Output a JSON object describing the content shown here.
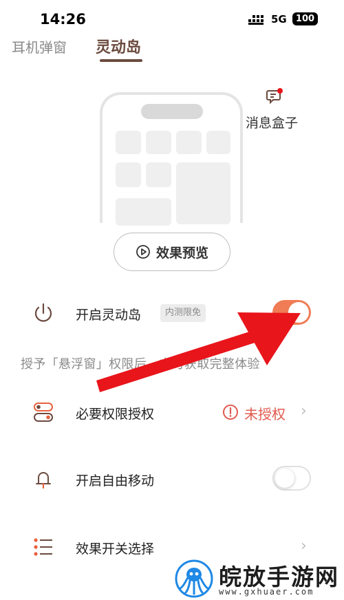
{
  "status_bar": {
    "time": "14:26",
    "network": "5G",
    "battery": "100"
  },
  "tabs": [
    {
      "label": "耳机弹窗"
    },
    {
      "label": "灵动岛"
    }
  ],
  "message_box": {
    "label": "消息盒子"
  },
  "preview_button": {
    "label": "效果预览"
  },
  "rows": {
    "enable_island": {
      "label": "开启灵动岛",
      "badge": "内测限免",
      "toggle_on": true
    },
    "hint": "授予「悬浮窗」权限后，方可获取完整体验",
    "permission": {
      "label": "必要权限授权",
      "status": "未授权"
    },
    "free_move": {
      "label": "开启自由移动",
      "toggle_on": false
    },
    "effect_switch": {
      "label": "效果开关选择"
    }
  },
  "watermark": {
    "title": "皖放手游网",
    "url": "www.gxhuaer.com"
  },
  "colors": {
    "accent": "#f07c55",
    "tab_active": "#6b4a3e",
    "warning": "#e05a4e",
    "arrow": "#e8151b"
  }
}
